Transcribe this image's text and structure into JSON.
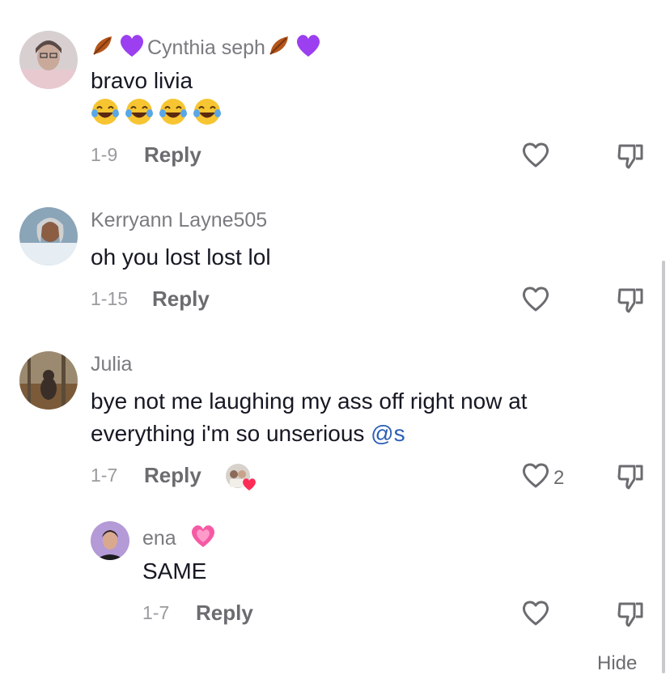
{
  "comments": [
    {
      "username": "Cynthia seph",
      "text": "bravo livia",
      "date": "1-9",
      "reply_label": "Reply",
      "likes": ""
    },
    {
      "username": "Kerryann Layne505",
      "text": "oh you lost lost lol",
      "date": "1-15",
      "reply_label": "Reply",
      "likes": ""
    },
    {
      "username": "Julia",
      "text_line1": "bye not me laughing my ass off right now at",
      "text_line2": "everything i'm so unserious ",
      "mention": "@s",
      "date": "1-7",
      "reply_label": "Reply",
      "likes": "2"
    }
  ],
  "reply": {
    "username": "ena",
    "text": "SAME",
    "date": "1-7",
    "reply_label": "Reply"
  },
  "hide_label": "Hide",
  "colors": {
    "username": "#7a7a80",
    "mention": "#2b5fb4",
    "heart_badge": "#fe2c55",
    "purple_heart": "#9b3ff0"
  }
}
